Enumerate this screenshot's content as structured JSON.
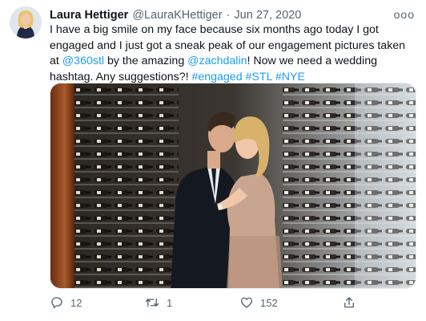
{
  "tweet": {
    "author_name": "Laura Hettiger",
    "handle": "@LauraKHettiger",
    "separator": "·",
    "date": "Jun 27, 2020",
    "more_label": "ooo",
    "text_parts": {
      "p1": "I have a big smile on my face because six months ago today I got engaged and I just got a sneak peak of our engagement pictures taken at ",
      "mention1": "@360stl",
      "p2": " by the amazing ",
      "mention2": "@zachdalin",
      "p3": "! Now we need a wedding hashtag. Any suggestions?! ",
      "tag1": "#engaged",
      "tag2": "#STL",
      "tag3": "#NYE"
    },
    "media_description": "engagement photo in wine cellar"
  },
  "actions": {
    "reply_count": "12",
    "retweet_count": "1",
    "like_count": "152"
  },
  "icons": {
    "reply": "reply-icon",
    "retweet": "retweet-icon",
    "like": "heart-icon",
    "share": "share-icon"
  },
  "colors": {
    "link": "#1d9bf0",
    "muted": "#536471",
    "text": "#0f1419"
  }
}
